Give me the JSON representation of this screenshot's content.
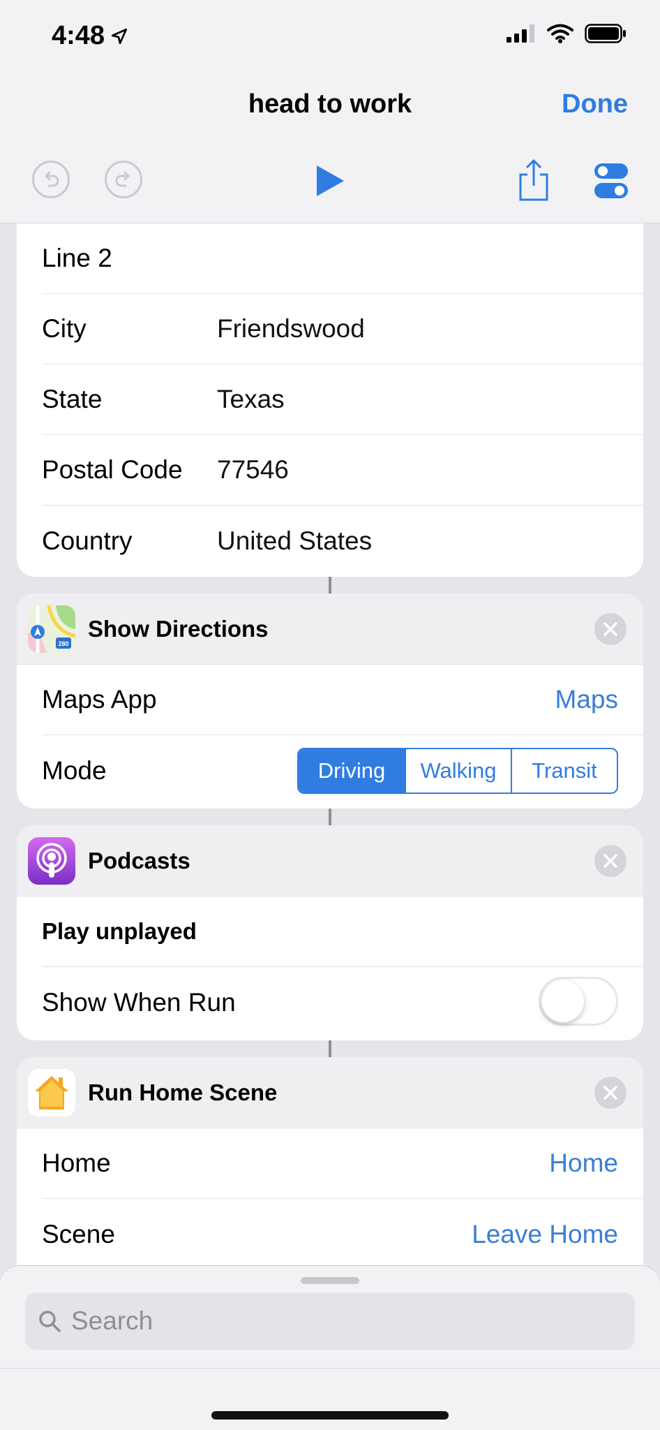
{
  "status_bar": {
    "time": "4:48"
  },
  "nav": {
    "title": "head to work",
    "done_label": "Done"
  },
  "address_card": {
    "rows": [
      {
        "label": "Line 2",
        "value": ""
      },
      {
        "label": "City",
        "value": "Friendswood"
      },
      {
        "label": "State",
        "value": "Texas"
      },
      {
        "label": "Postal Code",
        "value": "77546"
      },
      {
        "label": "Country",
        "value": "United States"
      }
    ]
  },
  "directions_card": {
    "title": "Show Directions",
    "maps_app_label": "Maps App",
    "maps_app_value": "Maps",
    "mode_label": "Mode",
    "mode_options": [
      "Driving",
      "Walking",
      "Transit"
    ],
    "mode_selected": "Driving",
    "icon_badge": "280"
  },
  "podcasts_card": {
    "title": "Podcasts",
    "action_label": "Play unplayed",
    "show_when_run_label": "Show When Run",
    "show_when_run": false
  },
  "home_card": {
    "title": "Run Home Scene",
    "home_label": "Home",
    "home_value": "Home",
    "scene_label": "Scene",
    "scene_value": "Leave Home"
  },
  "search": {
    "placeholder": "Search"
  },
  "colors": {
    "accent": "#2f7de1",
    "link": "#3a7dd6",
    "background": "#e5e5ea"
  }
}
